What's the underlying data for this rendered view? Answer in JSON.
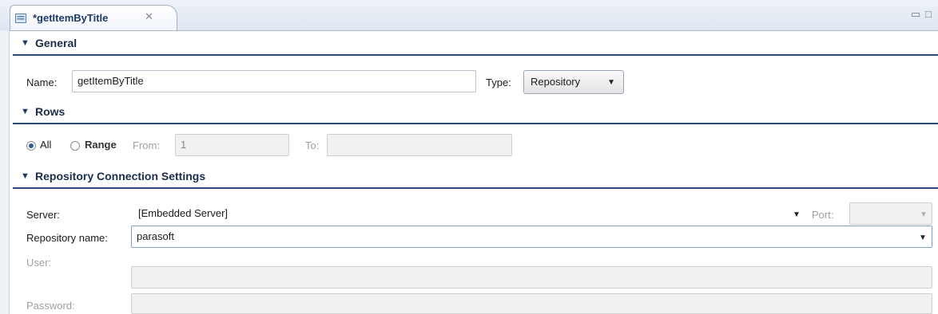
{
  "editor_tab": {
    "title": "*getItemByTitle",
    "close_glyph": "✕"
  },
  "window_controls": {
    "minimize": "▭",
    "maximize": "□"
  },
  "sections": {
    "general": "General",
    "rows": "Rows",
    "repo": "Repository Connection Settings"
  },
  "general": {
    "name_label": "Name:",
    "name_value": "getItemByTitle",
    "type_label": "Type:",
    "type_value": "Repository"
  },
  "rows": {
    "all_label": "All",
    "all_selected": true,
    "range_label": "Range",
    "from_label": "From:",
    "from_value": "1",
    "to_label": "To:",
    "to_value": ""
  },
  "repo": {
    "server_label": "Server:",
    "server_value": "[Embedded Server]",
    "port_label": "Port:",
    "port_value": "",
    "repo_name_label": "Repository name:",
    "repo_name_value": "parasoft",
    "user_label": "User:",
    "user_value": "",
    "password_label": "Password:",
    "password_value": ""
  },
  "icons": {
    "dropdown": "▼",
    "collapse": "▼"
  },
  "colors": {
    "section_rule": "#2a4a78",
    "radio_selected": "#2f5d9a"
  }
}
